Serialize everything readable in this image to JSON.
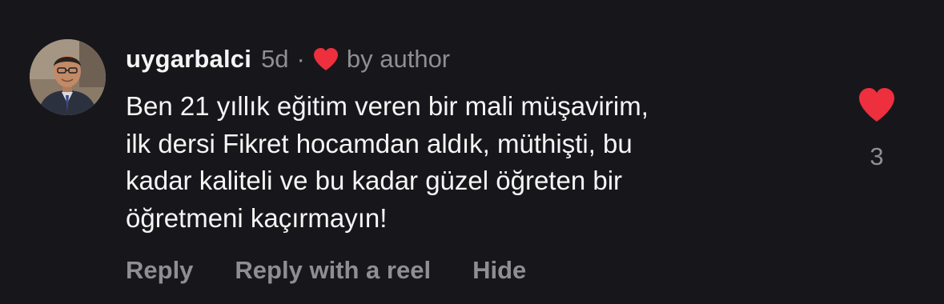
{
  "comment": {
    "username": "uygarbalci",
    "age": "5d",
    "separator": "·",
    "by_author": "by author",
    "author_heart_icon": "heart-filled-icon",
    "body_lines": [
      "Ben 21 yıllık eğitim veren bir mali müşavirim,",
      "ilk dersi Fikret hocamdan aldık, müthişti, bu",
      "kadar kaliteli ve bu kadar güzel öğreten bir",
      "öğretmeni kaçırmayın!"
    ],
    "like_count": "3",
    "like_icon": "heart-filled-icon"
  },
  "actions": {
    "reply": "Reply",
    "reply_reel": "Reply with a reel",
    "hide": "Hide"
  },
  "colors": {
    "background": "#17171b",
    "text": "#f5f5f5",
    "muted": "#8e8e93",
    "heart": "#ed2f3e"
  }
}
